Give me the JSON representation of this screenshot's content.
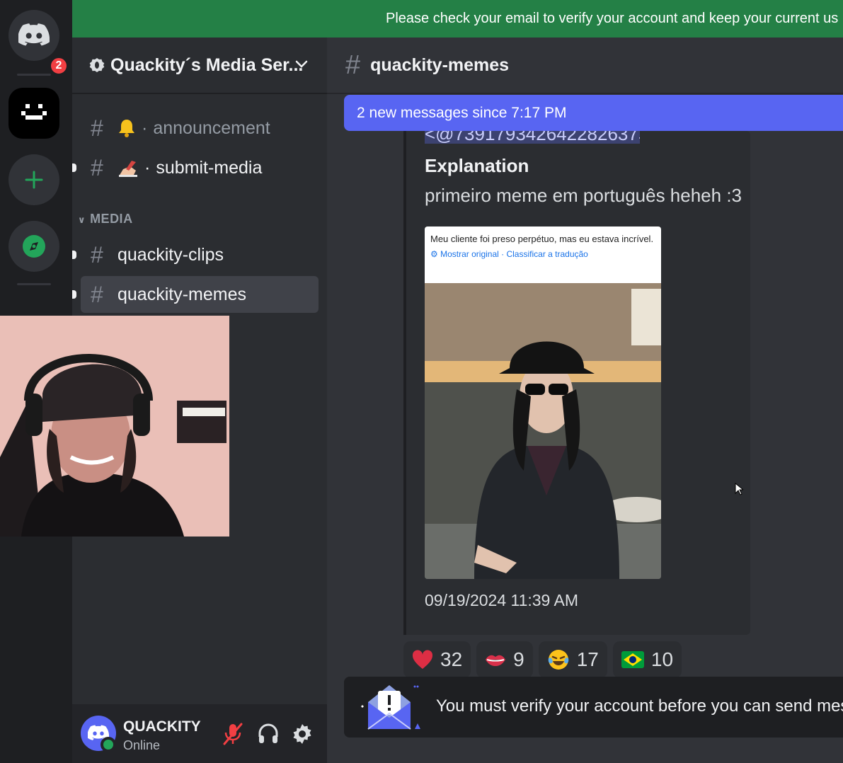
{
  "top_banner": {
    "text": "Please check your email to verify your account and keep your current us"
  },
  "rail": {
    "home_badge": "2"
  },
  "server": {
    "name": "Quackity´s Media Ser..."
  },
  "channels": [
    {
      "name": "announcement",
      "prefix": "·"
    },
    {
      "name": "submit-media",
      "prefix": "·"
    },
    {
      "name": "quackity-clips"
    },
    {
      "name": "quackity-memes"
    }
  ],
  "category": {
    "label": "MEDIA"
  },
  "user": {
    "name": "QUACKITY",
    "status": "Online"
  },
  "chat": {
    "channel_title": "quackity-memes",
    "new_messages_bar": "2 new messages since 7:17 PM"
  },
  "embed": {
    "mention": "<@739179342642282637>",
    "title": "Explanation",
    "description": "primeiro meme em português heheh :3",
    "image_caption_text": "Meu cliente foi preso perpétuo, mas eu estava incrível.",
    "image_caption_links": "Mostrar original · Classificar a tradução",
    "timestamp": "09/19/2024 11:39 AM"
  },
  "reactions": [
    {
      "emoji": "heart-emoji",
      "count": "32"
    },
    {
      "emoji": "lips-emoji",
      "count": "9"
    },
    {
      "emoji": "tears-of-joy-emoji",
      "count": "17"
    },
    {
      "emoji": "brazil-flag-emoji",
      "count": "10"
    }
  ],
  "verify_notice": {
    "text": "You must verify your account before you can send mess"
  },
  "colors": {
    "accent": "#5865f2",
    "success": "#248046",
    "danger": "#f23f43"
  }
}
